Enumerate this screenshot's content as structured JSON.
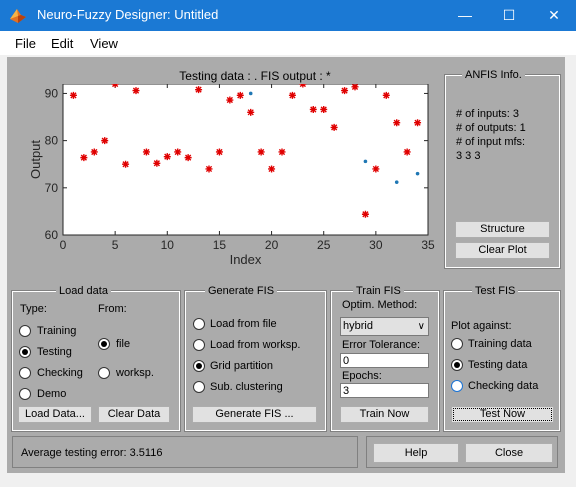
{
  "window": {
    "title": "Neuro-Fuzzy Designer: Untitled",
    "minimize": "—",
    "maximize": "☐",
    "close": "✕",
    "icon": "matlab-icon"
  },
  "menu": [
    "File",
    "Edit",
    "View"
  ],
  "chart": {
    "title": "Testing data : .   FIS output : *"
  },
  "chart_data": {
    "type": "scatter",
    "title": "Testing data : .   FIS output : *",
    "xlabel": "Index",
    "ylabel": "Output",
    "xlim": [
      0,
      35
    ],
    "ylim": [
      60,
      92
    ],
    "xticks": [
      0,
      5,
      10,
      15,
      20,
      25,
      30,
      35
    ],
    "yticks": [
      60,
      70,
      80,
      90
    ],
    "series": [
      {
        "name": "*",
        "marker": "star",
        "color": "#e00000",
        "x": [
          1,
          2,
          3,
          4,
          5,
          6,
          7,
          8,
          9,
          10,
          11,
          12,
          13,
          14,
          15,
          16,
          17,
          18,
          19,
          20,
          21,
          22,
          23,
          24,
          25,
          26,
          27,
          28,
          29,
          30,
          31,
          32,
          33,
          34
        ],
        "y": [
          89.6,
          76.4,
          77.6,
          80.0,
          92.0,
          75.0,
          90.6,
          77.6,
          75.2,
          76.6,
          77.6,
          76.4,
          90.8,
          74.0,
          77.6,
          88.6,
          89.6,
          86.0,
          77.6,
          74.0,
          77.6,
          89.6,
          92.0,
          86.6,
          86.6,
          82.8,
          90.6,
          91.4,
          64.4,
          74.0,
          89.6,
          83.8,
          77.6,
          83.8
        ]
      },
      {
        "name": ".",
        "marker": "dot",
        "color": "#1f77b4",
        "x": [
          18,
          29,
          32,
          34
        ],
        "y": [
          90.0,
          75.6,
          71.2,
          73.0
        ]
      }
    ]
  },
  "anfis_info": {
    "title": "ANFIS Info.",
    "lines": [
      "# of inputs: 3",
      "# of outputs: 1",
      "# of input mfs:",
      "3  3  3"
    ],
    "structure_btn": "Structure",
    "clear_plot_btn": "Clear Plot"
  },
  "load_data": {
    "title": "Load data",
    "type_label": "Type:",
    "from_label": "From:",
    "types": [
      "Training",
      "Testing",
      "Checking",
      "Demo"
    ],
    "selected_type": "Testing",
    "sources": [
      "file",
      "worksp."
    ],
    "selected_source": "file",
    "load_btn": "Load Data...",
    "clear_btn": "Clear Data"
  },
  "generate_fis": {
    "title": "Generate FIS",
    "options": [
      "Load from file",
      "Load from worksp.",
      "Grid partition",
      "Sub. clustering"
    ],
    "selected": "Grid partition",
    "btn": "Generate FIS ..."
  },
  "train_fis": {
    "title": "Train FIS",
    "method_label": "Optim. Method:",
    "method_value": "hybrid",
    "tol_label": "Error Tolerance:",
    "tol_value": "0",
    "epochs_label": "Epochs:",
    "epochs_value": "3",
    "btn": "Train Now"
  },
  "test_fis": {
    "title": "Test FIS",
    "plot_label": "Plot against:",
    "options": [
      "Training data",
      "Testing data",
      "Checking data"
    ],
    "selected": "Testing data",
    "btn": "Test Now"
  },
  "status": {
    "text": "Average testing error: 3.5116"
  },
  "help_btn": "Help",
  "close_btn": "Close"
}
